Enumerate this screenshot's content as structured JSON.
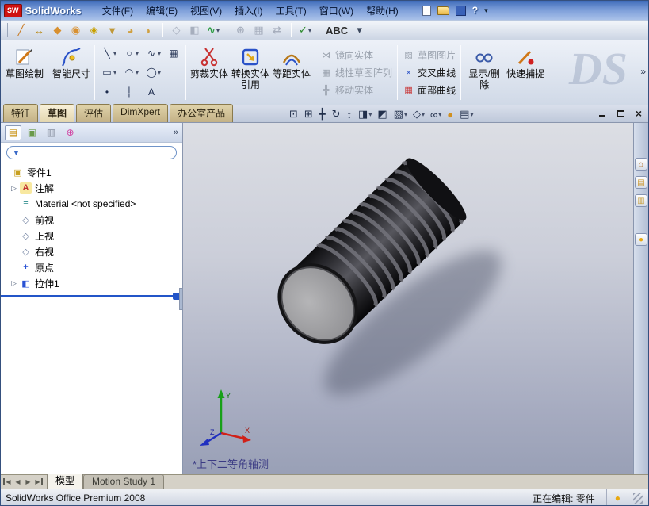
{
  "titlebar": {
    "badge": "SW",
    "title": "SolidWorks",
    "menu_items": [
      {
        "label": "文件(F)",
        "name": "menu-file"
      },
      {
        "label": "编辑(E)",
        "name": "menu-edit"
      },
      {
        "label": "视图(V)",
        "name": "menu-view"
      },
      {
        "label": "插入(I)",
        "name": "menu-insert"
      },
      {
        "label": "工具(T)",
        "name": "menu-tools"
      },
      {
        "label": "窗口(W)",
        "name": "menu-window"
      },
      {
        "label": "帮助(H)",
        "name": "menu-help"
      }
    ],
    "help_icon": "?",
    "chevron": "▾"
  },
  "toolbar": {
    "icons": [
      {
        "name": "sketch-tool-icon",
        "glyph": "╱",
        "color": "#c87820"
      },
      {
        "name": "dimension-tool-icon",
        "glyph": "↔",
        "color": "#b8860b"
      },
      {
        "name": "extrude-tool-icon",
        "glyph": "◆",
        "color": "#d89030"
      },
      {
        "name": "revolve-tool-icon",
        "glyph": "◉",
        "color": "#d89030"
      },
      {
        "name": "swept-tool-icon",
        "glyph": "◈",
        "color": "#c8a000"
      },
      {
        "name": "loft-tool-icon",
        "glyph": "▼",
        "color": "#c09838"
      },
      {
        "name": "fillet-tool-icon",
        "glyph": "◕",
        "color": "#d0a040"
      },
      {
        "name": "chamfer-tool-icon",
        "glyph": "◗",
        "color": "#d0a040"
      },
      {
        "sep": true
      },
      {
        "name": "reference-geometry-icon",
        "glyph": "◇",
        "color": "#9aa2b2",
        "disabled": true
      },
      {
        "name": "instant3d-icon",
        "glyph": "◧",
        "color": "#9aa2b2",
        "disabled": true
      },
      {
        "name": "curves-icon",
        "glyph": "∿",
        "color": "#2a9a40",
        "chev": "▾"
      },
      {
        "sep": true
      },
      {
        "name": "mate-icon",
        "glyph": "⊕",
        "color": "#9aa2b2",
        "disabled": true
      },
      {
        "name": "component-pattern-icon",
        "glyph": "▦",
        "color": "#9aa2b2",
        "disabled": true
      },
      {
        "name": "move-component-icon",
        "glyph": "⇄",
        "color": "#9aa2b2",
        "disabled": true
      },
      {
        "sep": true
      },
      {
        "name": "design-checker-icon",
        "glyph": "✓",
        "color": "#2a8a2a",
        "chev": "▾"
      },
      {
        "sep": true
      },
      {
        "name": "spell-checker-icon",
        "glyph": "ABC",
        "color": "#2c2c2c"
      },
      {
        "name": "toolbar-overflow-icon",
        "glyph": "▾",
        "color": "#3c485e"
      }
    ]
  },
  "command_manager": {
    "sketch_button": {
      "label": "草图绘制"
    },
    "smart_dimension_button": {
      "label": "智能尺寸"
    },
    "entity_tools": [
      {
        "name": "line-tool-icon",
        "glyph": "╲",
        "chev": "▾"
      },
      {
        "name": "rectangle-tool-icon",
        "glyph": "▭",
        "chev": "▾"
      },
      {
        "name": "point-tool-icon",
        "glyph": "•",
        "chev": ""
      },
      {
        "name": "circle-tool-icon",
        "glyph": "○",
        "chev": "▾"
      },
      {
        "name": "arc-tool-icon",
        "glyph": "◠",
        "chev": "▾"
      },
      {
        "name": "centerline-tool-icon",
        "glyph": "┆",
        "chev": ""
      },
      {
        "name": "spline-tool-icon",
        "glyph": "∿",
        "chev": "▾"
      },
      {
        "name": "ellipse-tool-icon",
        "glyph": "◯",
        "chev": "▾"
      },
      {
        "name": "text-tool-icon",
        "glyph": "A",
        "chev": ""
      },
      {
        "name": "construction-grid-icon",
        "glyph": "▦",
        "chev": ""
      }
    ],
    "trim_button": {
      "label": "剪裁实体"
    },
    "convert_button": {
      "label": "转换实体引用"
    },
    "offset_button": {
      "label": "等距实体"
    },
    "mirror_group": [
      {
        "name": "mirror-entities-item",
        "glyph": "⋈",
        "color": "#98a0ac",
        "label": "镜向实体",
        "disabled": true
      },
      {
        "name": "linear-sketch-pattern-item",
        "glyph": "▦",
        "color": "#98a0ac",
        "label": "线性草图阵列",
        "disabled": true
      },
      {
        "name": "move-entities-item",
        "glyph": "╬",
        "color": "#98a0ac",
        "label": "移动实体",
        "disabled": true
      }
    ],
    "curve_group": [
      {
        "name": "sketch-picture-item",
        "glyph": "▨",
        "color": "#98a0ac",
        "label": "草图图片",
        "disabled": true
      },
      {
        "name": "intersection-curve-item",
        "glyph": "×",
        "color": "#2a52c8",
        "label": "交叉曲线"
      },
      {
        "name": "face-curves-item",
        "glyph": "▦",
        "color": "#c83232",
        "label": "面部曲线"
      }
    ],
    "display_delete_button": {
      "label": "显示/删除"
    },
    "quick_snap_button": {
      "label": "快速捕捉"
    },
    "overflow_icon": "»",
    "watermark": "DS"
  },
  "cm_tabs": [
    {
      "label": "特征",
      "name": "tab-features"
    },
    {
      "label": "草图",
      "name": "tab-sketch",
      "active": true
    },
    {
      "label": "评估",
      "name": "tab-evaluate"
    },
    {
      "label": "DimXpert",
      "name": "tab-dimxpert"
    },
    {
      "label": "办公室产品",
      "name": "tab-office-products"
    }
  ],
  "headsup": [
    {
      "name": "zoom-fit-icon",
      "glyph": "⊡",
      "chev": ""
    },
    {
      "name": "zoom-area-icon",
      "glyph": "⊞",
      "chev": ""
    },
    {
      "name": "pan-icon",
      "glyph": "╋",
      "chev": ""
    },
    {
      "name": "rotate-view-icon",
      "glyph": "↻",
      "chev": ""
    },
    {
      "name": "zoom-inout-icon",
      "glyph": "↕",
      "chev": ""
    },
    {
      "name": "standard-views-icon",
      "glyph": "◨",
      "chev": "▾"
    },
    {
      "name": "section-view-icon",
      "glyph": "◩",
      "chev": ""
    },
    {
      "name": "view-orientation-icon",
      "glyph": "▧",
      "chev": "▾"
    },
    {
      "name": "display-style-icon",
      "glyph": "◇",
      "chev": "▾"
    },
    {
      "name": "hide-show-items-icon",
      "glyph": "∞",
      "chev": "▾"
    },
    {
      "name": "edit-appearance-icon",
      "glyph": "●",
      "color": "#d09020",
      "chev": ""
    },
    {
      "name": "apply-scene-icon",
      "glyph": "▤",
      "chev": "▾"
    }
  ],
  "window_controls": {
    "close_glyph": "×"
  },
  "panel": {
    "manager_tabs": [
      {
        "name": "featuremanager-tab",
        "glyph": "▤",
        "color": "#c89010",
        "active": true
      },
      {
        "name": "propertymanager-tab",
        "glyph": "▣",
        "color": "#6a9a4a"
      },
      {
        "name": "configurationmanager-tab",
        "glyph": "▥",
        "color": "#8890a0"
      },
      {
        "name": "dimxpertmanager-tab",
        "glyph": "⊕",
        "color": "#d040a0"
      }
    ],
    "chevron": "»",
    "filter": {
      "icon_glyph": "▼"
    },
    "tree": [
      {
        "name": "tree-item-part",
        "cls": "root",
        "arrow": "",
        "glyph": "▣",
        "color": "#c8a020",
        "label": "零件1"
      },
      {
        "name": "tree-item-annotations",
        "arrow": "▷",
        "glyph": "A",
        "color": "#c03030",
        "bg": "#f8e8a0",
        "label": "注解"
      },
      {
        "name": "tree-item-material",
        "arrow": "",
        "glyph": "≡",
        "color": "#2a8a8a",
        "label": "Material <not specified>"
      },
      {
        "name": "tree-item-front-plane",
        "arrow": "",
        "glyph": "◇",
        "color": "#7080a0",
        "label": "前视"
      },
      {
        "name": "tree-item-top-plane",
        "arrow": "",
        "glyph": "◇",
        "color": "#7080a0",
        "label": "上视"
      },
      {
        "name": "tree-item-right-plane",
        "arrow": "",
        "glyph": "◇",
        "color": "#7080a0",
        "label": "右视"
      },
      {
        "name": "tree-item-origin",
        "arrow": "",
        "glyph": "+",
        "color": "#2a52d4",
        "label": "原点"
      },
      {
        "name": "tree-item-extrude1",
        "arrow": "▷",
        "glyph": "◧",
        "color": "#2a52d4",
        "label": "拉伸1"
      }
    ]
  },
  "viewport": {
    "view_label": "*上下二等角轴测",
    "axis_labels": {
      "x": "X",
      "y": "Y",
      "z": "Z"
    }
  },
  "taskpane": {
    "icons": [
      {
        "name": "solidworks-resources-icon",
        "glyph": "⌂",
        "color": "#b06a20"
      },
      {
        "name": "design-library-icon",
        "glyph": "▤",
        "color": "#c89020"
      },
      {
        "name": "file-explorer-icon",
        "glyph": "▥",
        "color": "#c8a040"
      },
      {
        "name": "appearances-icon",
        "glyph": "●",
        "color": "#e8a810"
      }
    ]
  },
  "bottom": {
    "nav": [
      {
        "name": "tab-scroll-first-icon",
        "glyph": "◀",
        "cls": "bar-l"
      },
      {
        "name": "tab-scroll-prev-icon",
        "glyph": "◀"
      },
      {
        "name": "tab-scroll-next-icon",
        "glyph": "▶"
      },
      {
        "name": "tab-scroll-last-icon",
        "glyph": "▶",
        "cls": "bar-r"
      }
    ],
    "tabs": [
      {
        "label": "模型",
        "name": "tab-model",
        "active": true
      },
      {
        "label": "Motion Study 1",
        "name": "tab-motion-study-1"
      }
    ]
  },
  "statusbar": {
    "left": "SolidWorks Office Premium 2008",
    "editing": "正在编辑: 零件",
    "icon_glyph": "●"
  }
}
